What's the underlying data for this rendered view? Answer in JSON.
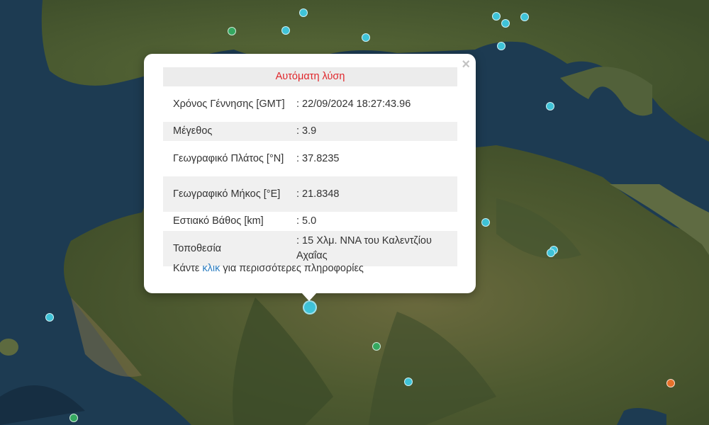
{
  "popup": {
    "title": "Αυτόματη λύση",
    "close_symbol": "×",
    "rows": [
      {
        "label": "Χρόνος Γέννησης [GMT]",
        "value": ": 22/09/2024 18:27:43.96"
      },
      {
        "label": "Μέγεθος",
        "value": ": 3.9"
      },
      {
        "label": "Γεωγραφικό Πλάτος [°N]",
        "value": ": 37.8235"
      },
      {
        "label": "Γεωγραφικό Μήκος [°E]",
        "value": ": 21.8348"
      },
      {
        "label": "Εστιακό Βάθος [km]",
        "value": ": 5.0"
      },
      {
        "label": "Τοποθεσία",
        "value": ": 15 Χλμ. ΝΝΑ του Καλεντζίου Αχαΐας"
      }
    ],
    "more_prefix": "Κάντε ",
    "more_link": "κλικ",
    "more_suffix": " για περισσότερες πληροφορίες"
  },
  "colors": {
    "cyan": "#3fc3d8",
    "green": "#35a860",
    "orange": "#e6702a",
    "sea": "#1d3b52",
    "land": "#4f5a35"
  }
}
